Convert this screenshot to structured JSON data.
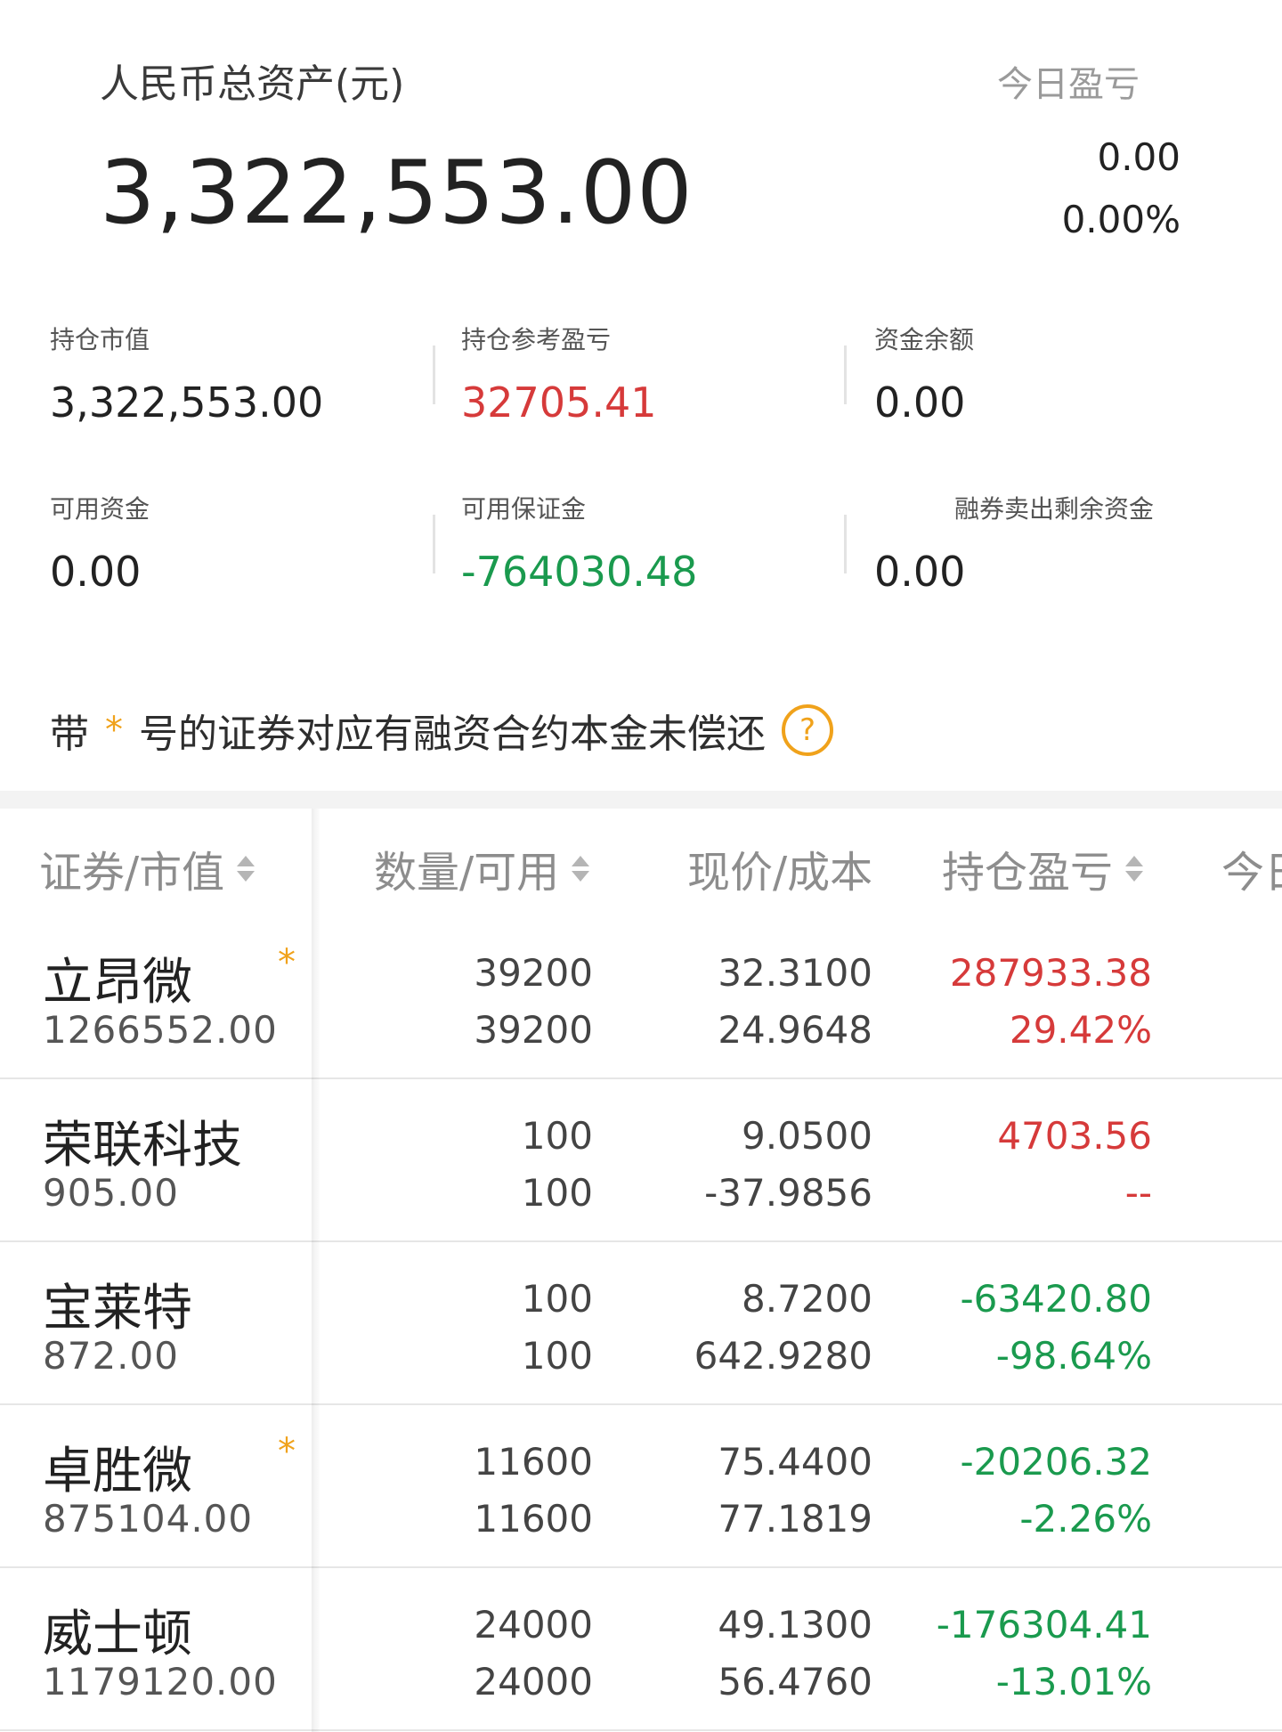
{
  "header": {
    "total_label": "人民币总资产(元)",
    "total_value": "3,322,553.00",
    "today_label": "今日盈亏",
    "today_amount": "0.00",
    "today_pct": "0.00%"
  },
  "metrics": [
    {
      "label": "持仓市值",
      "value": "3,322,553.00",
      "tone": "neutral"
    },
    {
      "label": "持仓参考盈亏",
      "value": "32705.41",
      "tone": "red"
    },
    {
      "label": "资金余额",
      "value": "0.00",
      "tone": "neutral"
    },
    {
      "label": "可用资金",
      "value": "0.00",
      "tone": "neutral"
    },
    {
      "label": "可用保证金",
      "value": "-764030.48",
      "tone": "green"
    },
    {
      "label": "融券卖出剩余资金",
      "value": "0.00",
      "tone": "neutral"
    }
  ],
  "notice": {
    "prefix": "带",
    "star": "*",
    "text": "号的证券对应有融资合约本金未偿还",
    "help_glyph": "?"
  },
  "table": {
    "headers": {
      "security": "证券/市值",
      "qty": "数量/可用",
      "price": "现价/成本",
      "pnl": "持仓盈亏",
      "today": "今日"
    },
    "rows": [
      {
        "name": "立昂微",
        "market_value": "1266552.00",
        "margin": "*",
        "qty": "39200",
        "available": "39200",
        "price": "32.3100",
        "cost": "24.9648",
        "pnl": "287933.38",
        "pnl_pct": "29.42%",
        "tone": "red"
      },
      {
        "name": "荣联科技",
        "market_value": "905.00",
        "margin": "",
        "qty": "100",
        "available": "100",
        "price": "9.0500",
        "cost": "-37.9856",
        "pnl": "4703.56",
        "pnl_pct": "--",
        "tone": "red"
      },
      {
        "name": "宝莱特",
        "market_value": "872.00",
        "margin": "",
        "qty": "100",
        "available": "100",
        "price": "8.7200",
        "cost": "642.9280",
        "pnl": "-63420.80",
        "pnl_pct": "-98.64%",
        "tone": "green"
      },
      {
        "name": "卓胜微",
        "market_value": "875104.00",
        "margin": "*",
        "qty": "11600",
        "available": "11600",
        "price": "75.4400",
        "cost": "77.1819",
        "pnl": "-20206.32",
        "pnl_pct": "-2.26%",
        "tone": "green"
      },
      {
        "name": "威士顿",
        "market_value": "1179120.00",
        "margin": "",
        "qty": "24000",
        "available": "24000",
        "price": "49.1300",
        "cost": "56.4760",
        "pnl": "-176304.41",
        "pnl_pct": "-13.01%",
        "tone": "green"
      }
    ]
  },
  "colors": {
    "up_red": "#d63a3a",
    "down_green": "#1a9a4e",
    "accent_orange": "#f0a21b"
  }
}
